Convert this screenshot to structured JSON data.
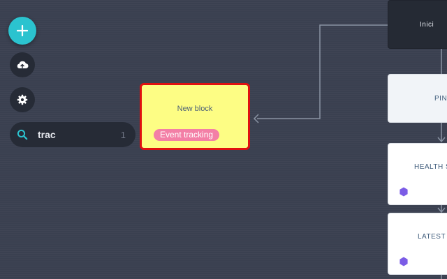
{
  "toolbar": {
    "add_button_icon": "plus-icon",
    "cloud_button_icon": "cloud-upload-icon",
    "settings_button_icon": "gear-icon"
  },
  "search": {
    "value": "trac",
    "result_count": "1",
    "icon": "search-icon"
  },
  "canvas": {
    "selected_block": {
      "title": "New block",
      "tag": "Event tracking",
      "background": "#fdfd84",
      "border": "#e01010",
      "tag_color": "#f37fa6"
    },
    "flow_blocks": [
      {
        "title": "Inici"
      },
      {
        "title": "PING"
      },
      {
        "title": "HEALTH S"
      },
      {
        "title": "LATEST M"
      }
    ]
  },
  "colors": {
    "accent": "#2bc3cf",
    "canvas_bg": "#3a4050",
    "hex_badge": "#7b5ce6"
  }
}
